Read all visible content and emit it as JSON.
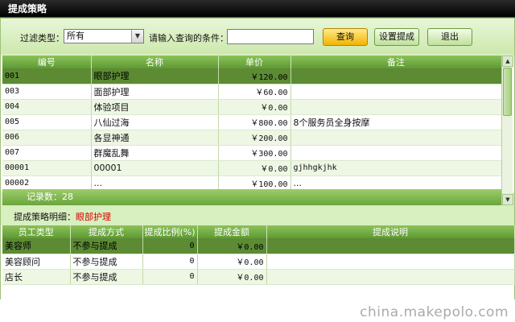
{
  "window": {
    "title": "提成策略"
  },
  "filter": {
    "type_label": "过滤类型：",
    "type_value": "所有",
    "condition_label": "请输入查询的条件：",
    "condition_value": "",
    "query_button": "查询",
    "set_commission_button": "设置提成",
    "exit_button": "退出"
  },
  "upper_table": {
    "columns": [
      "编号",
      "名称",
      "单价",
      "备注"
    ],
    "rows": [
      {
        "id": "001",
        "name": "眼部护理",
        "price": "￥120.00",
        "note": ""
      },
      {
        "id": "003",
        "name": "面部护理",
        "price": "￥60.00",
        "note": ""
      },
      {
        "id": "004",
        "name": "体验项目",
        "price": "￥0.00",
        "note": ""
      },
      {
        "id": "005",
        "name": "八仙过海",
        "price": "￥800.00",
        "note": "8个服务员全身按摩"
      },
      {
        "id": "006",
        "name": "各显神通",
        "price": "￥200.00",
        "note": ""
      },
      {
        "id": "007",
        "name": "群魔乱舞",
        "price": "￥300.00",
        "note": ""
      },
      {
        "id": "00001",
        "name": "00001",
        "price": "￥0.00",
        "note": "gjhhgkjhk"
      },
      {
        "id": "00002",
        "name": "...",
        "price": "￥100.00",
        "note": "..."
      }
    ],
    "selected_index": 0
  },
  "record_count": {
    "label": "记录数：",
    "value": "28"
  },
  "detail": {
    "label": "提成策略明细：",
    "name": "眼部护理"
  },
  "lower_table": {
    "columns": [
      "员工类型",
      "提成方式",
      "提成比例(%)",
      "提成金额",
      "提成说明"
    ],
    "rows": [
      {
        "type": "美容师",
        "mode": "不参与提成",
        "ratio": "0",
        "amount": "￥0.00",
        "desc": ""
      },
      {
        "type": "美容顾问",
        "mode": "不参与提成",
        "ratio": "0",
        "amount": "￥0.00",
        "desc": ""
      },
      {
        "type": "店长",
        "mode": "不参与提成",
        "ratio": "0",
        "amount": "￥0.00",
        "desc": ""
      }
    ],
    "selected_index": 0
  },
  "watermark": "china.makepolo.com"
}
